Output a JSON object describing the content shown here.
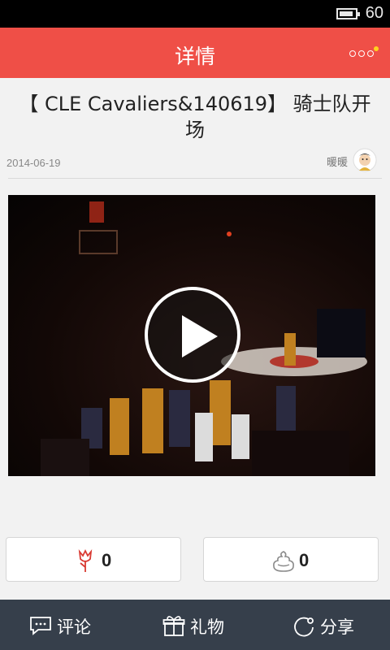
{
  "status_bar": {
    "battery_level": "60"
  },
  "header": {
    "title": "详情",
    "more_icon": "more-dots-icon",
    "accent": "#ef4f47"
  },
  "article": {
    "title": "【 CLE Cavaliers&140619】 骑士队开场",
    "date": "2014-06-19",
    "author": "暖暖"
  },
  "video": {
    "play_icon": "play-icon"
  },
  "votes": {
    "flower": {
      "icon": "flower-icon",
      "count": "0"
    },
    "poop": {
      "icon": "poop-icon",
      "count": "0"
    }
  },
  "bottom_bar": {
    "comment": "评论",
    "gift": "礼物",
    "share": "分享"
  }
}
